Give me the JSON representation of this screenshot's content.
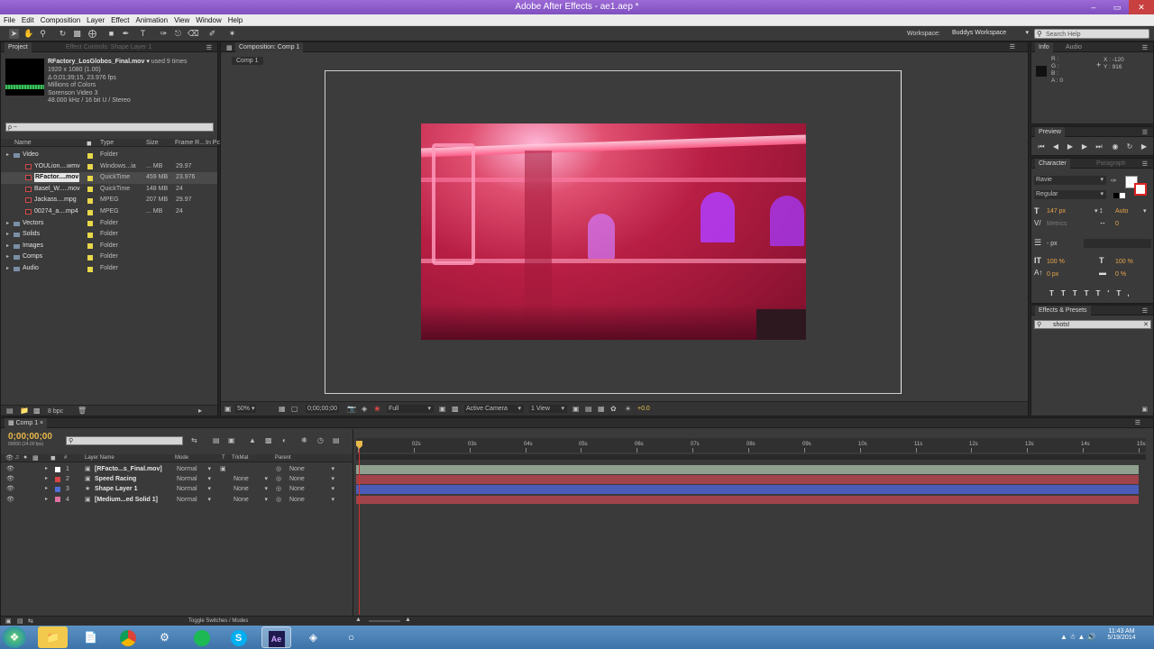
{
  "window": {
    "title": "Adobe After Effects - ae1.aep *"
  },
  "menu": [
    "File",
    "Edit",
    "Composition",
    "Layer",
    "Effect",
    "Animation",
    "View",
    "Window",
    "Help"
  ],
  "toolbar": {
    "workspace_label": "Workspace:",
    "workspace_value": "Buddys Workspace",
    "search_placeholder": "Search Help"
  },
  "project": {
    "tab_project": "Project",
    "tab_effect_controls": "Effect Controls: Shape Layer 1",
    "item_name": "RFactory_LosGlobos_Final.mov",
    "item_used": "used 9 times",
    "item_info": [
      "1920 x 1080 (1.00)",
      "Δ 0;01;39;15, 23.976 fps",
      "Millions of Colors",
      "Sorenson Video 3",
      "48.000 kHz / 16 bit U / Stereo"
    ],
    "search_placeholder": "ρ ~",
    "columns": [
      "Name",
      "Type",
      "Size",
      "Frame R...",
      "In Pc"
    ],
    "rows": [
      {
        "name": "Video",
        "type": "Folder",
        "size": "",
        "fps": "",
        "color": "#e8d84a",
        "indent": 0,
        "folder": true
      },
      {
        "name": "YOULion....wmv",
        "type": "Windows...ia",
        "size": "... MB",
        "fps": "29.97",
        "color": "#e8d84a",
        "indent": 1,
        "folder": false
      },
      {
        "name": "RFactor....mov",
        "type": "QuickTime",
        "size": "459 MB",
        "fps": "23.976",
        "color": "#e8d84a",
        "indent": 1,
        "folder": false,
        "selected": true
      },
      {
        "name": "Basel_W.....mov",
        "type": "QuickTime",
        "size": "148 MB",
        "fps": "24",
        "color": "#e8d84a",
        "indent": 1,
        "folder": false
      },
      {
        "name": "Jackass....mpg",
        "type": "MPEG",
        "size": "207 MB",
        "fps": "29.97",
        "color": "#e8d84a",
        "indent": 1,
        "folder": false
      },
      {
        "name": "00274_a....mp4",
        "type": "MPEG",
        "size": "... MB",
        "fps": "24",
        "color": "#e8d84a",
        "indent": 1,
        "folder": false
      },
      {
        "name": "Vectors",
        "type": "Folder",
        "size": "",
        "fps": "",
        "color": "#e8d84a",
        "indent": 0,
        "folder": true
      },
      {
        "name": "Solids",
        "type": "Folder",
        "size": "",
        "fps": "",
        "color": "#e8d84a",
        "indent": 0,
        "folder": true
      },
      {
        "name": "Images",
        "type": "Folder",
        "size": "",
        "fps": "",
        "color": "#e8d84a",
        "indent": 0,
        "folder": true
      },
      {
        "name": "Comps",
        "type": "Folder",
        "size": "",
        "fps": "",
        "color": "#e8d84a",
        "indent": 0,
        "folder": true
      },
      {
        "name": "Audio",
        "type": "Folder",
        "size": "",
        "fps": "",
        "color": "#e8d84a",
        "indent": 0,
        "folder": true
      }
    ],
    "bpc": "8 bpc"
  },
  "composition": {
    "tab": "Composition: Comp 1",
    "breadcrumb": "Comp 1",
    "zoom": "50%",
    "timecode": "0;00;00;00",
    "resolution": "Full",
    "camera": "Active Camera",
    "views": "1 View",
    "exposure": "+0.0"
  },
  "info": {
    "tab_info": "Info",
    "tab_audio": "Audio",
    "r": "R :",
    "g": "G :",
    "b": "B :",
    "a": "A : 0",
    "x": "X : -120",
    "y": "Y : 916"
  },
  "preview": {
    "tab": "Preview"
  },
  "character": {
    "tab_character": "Character",
    "tab_paragraph": "Paragraph",
    "font": "Ravie",
    "style": "Regular",
    "size": "147 px",
    "leading": "Auto",
    "kerning": "Metrics",
    "tracking": "0",
    "stroke": "- px",
    "vscale": "100 %",
    "hscale": "100 %",
    "baseline": "0 px",
    "tsume": "0 %"
  },
  "effects": {
    "tab": "Effects & Presets",
    "search_value": "shots!"
  },
  "timeline": {
    "tab": "Comp 1",
    "timecode": "0;00;00;00",
    "timecode_sub": "00000 (24.00 fps)",
    "columns": [
      "#",
      "Layer Name",
      "Mode",
      "T",
      "TrkMat",
      "Parent"
    ],
    "ruler": [
      "0s",
      "02s",
      "03s",
      "04s",
      "05s",
      "06s",
      "07s",
      "08s",
      "09s",
      "10s",
      "11s",
      "12s",
      "13s",
      "14s",
      "15s"
    ],
    "layers": [
      {
        "num": "1",
        "name": "[RFacto...s_Final.mov]",
        "mode": "Normal",
        "trkmat": "",
        "parent": "None",
        "color": "#ffffff",
        "bar": "#8fa08f"
      },
      {
        "num": "2",
        "name": "Speed Racing",
        "mode": "Normal",
        "trkmat": "None",
        "parent": "None",
        "color": "#d84545",
        "bar": "#a0434a"
      },
      {
        "num": "3",
        "name": "Shape Layer 1",
        "mode": "Normal",
        "trkmat": "None",
        "parent": "None",
        "color": "#4f6fd6",
        "bar": "#4b5bb8"
      },
      {
        "num": "4",
        "name": "[Medium...ed Solid 1]",
        "mode": "Normal",
        "trkmat": "None",
        "parent": "None",
        "color": "#e070a0",
        "bar": "#a0434a"
      }
    ],
    "toggle_label": "Toggle Switches / Modes"
  },
  "taskbar": {
    "time": "11:43 AM",
    "date": "5/19/2014"
  }
}
